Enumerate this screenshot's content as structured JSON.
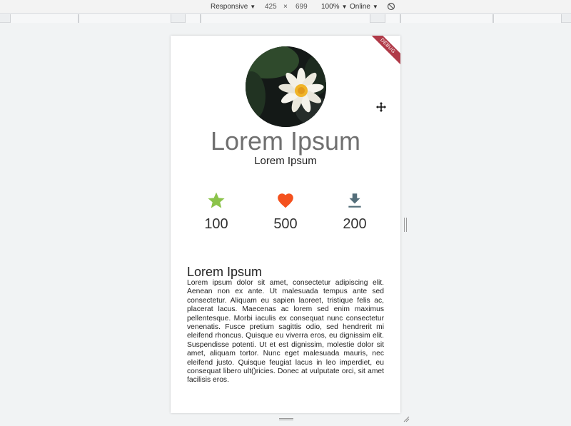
{
  "devtools": {
    "device": "Responsive",
    "width": "425",
    "times": "×",
    "height": "699",
    "zoom": "100%",
    "network": "Online"
  },
  "app": {
    "debug_banner": "DEBUG",
    "title": "Lorem Ipsum",
    "subtitle": "Lorem Ipsum",
    "stats": [
      {
        "icon": "star-icon",
        "value": "100",
        "color": "#8bc34a"
      },
      {
        "icon": "heart-icon",
        "value": "500",
        "color": "#f4511e"
      },
      {
        "icon": "download-icon",
        "value": "200",
        "color": "#546e7a"
      }
    ],
    "section_title": "Lorem Ipsum",
    "body": "Lorem ipsum dolor sit amet, consectetur adipiscing elit. Aenean non ex ante. Ut malesuada tempus ante sed consectetur. Aliquam eu sapien laoreet, tristique felis ac, placerat lacus. Maecenas ac lorem sed enim maximus pellentesque. Morbi iaculis ex consequat nunc consectetur venenatis. Fusce pretium sagittis odio, sed hendrerit mi eleifend rhoncus. Quisque eu viverra eros, eu dignissim elit. Suspendisse potenti. Ut et est dignissim, molestie dolor sit amet, aliquam tortor. Nunc eget malesuada mauris, nec eleifend justo. Quisque feugiat lacus in leo imperdiet, eu consequat libero ult()ricies. Donec at vulputate orci, sit amet facilisis eros."
  }
}
